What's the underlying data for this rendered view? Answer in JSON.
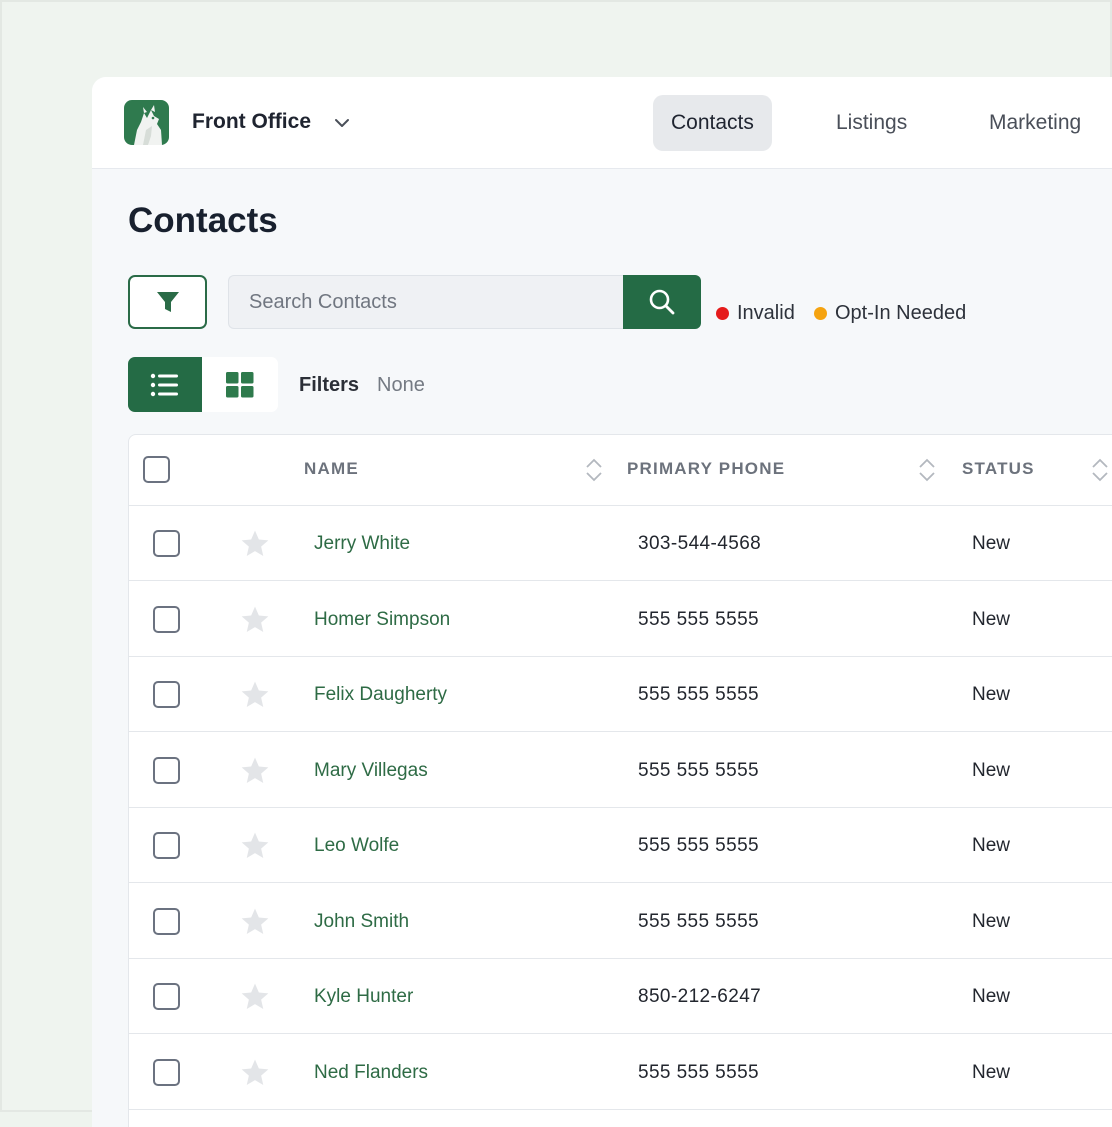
{
  "topbar": {
    "org_name": "Front Office",
    "nav": [
      {
        "label": "Contacts",
        "active": true
      },
      {
        "label": "Listings",
        "active": false
      },
      {
        "label": "Marketing",
        "active": false
      }
    ]
  },
  "page": {
    "title": "Contacts",
    "search_placeholder": "Search Contacts",
    "legend": [
      {
        "label": "Invalid",
        "color": "#e51b1b"
      },
      {
        "label": "Opt-In Needed",
        "color": "#f5a310"
      }
    ],
    "filters_label": "Filters",
    "filters_value": "None"
  },
  "table": {
    "columns": [
      "NAME",
      "PRIMARY PHONE",
      "STATUS"
    ],
    "rows": [
      {
        "name": "Jerry White",
        "phone": "303-544-4568",
        "status": "New"
      },
      {
        "name": "Homer Simpson",
        "phone": "555 555 5555",
        "status": "New"
      },
      {
        "name": "Felix Daugherty",
        "phone": "555 555 5555",
        "status": "New"
      },
      {
        "name": "Mary Villegas",
        "phone": "555 555 5555",
        "status": "New"
      },
      {
        "name": "Leo Wolfe",
        "phone": "555 555 5555",
        "status": "New"
      },
      {
        "name": "John Smith",
        "phone": "555 555 5555",
        "status": "New"
      },
      {
        "name": "Kyle Hunter",
        "phone": "850-212-6247",
        "status": "New"
      },
      {
        "name": "Ned Flanders",
        "phone": "555 555 5555",
        "status": "New"
      }
    ]
  },
  "colors": {
    "brand_green": "#246b45",
    "link_green": "#2e6b45"
  },
  "icons": {
    "logo": "wolf-logo-icon",
    "org_caret": "chevron-down-icon",
    "filter": "funnel-icon",
    "search": "magnifier-icon",
    "list_view": "list-icon",
    "grid_view": "grid-icon",
    "sort": "sort-icon",
    "favorite": "star-icon"
  }
}
